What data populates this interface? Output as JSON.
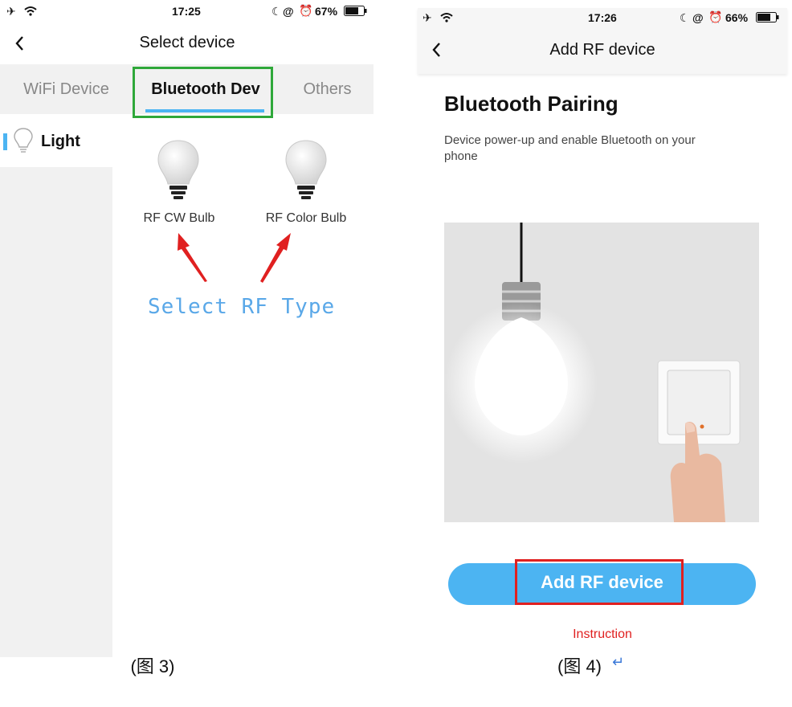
{
  "left_screen": {
    "status": {
      "time": "17:25",
      "battery": "67%"
    },
    "nav": {
      "title": "Select device"
    },
    "tabs": [
      {
        "label": "WiFi Device"
      },
      {
        "label": "Bluetooth Dev"
      },
      {
        "label": "Others"
      }
    ],
    "sidebar": {
      "items": [
        {
          "label": "Light"
        }
      ]
    },
    "devices": [
      {
        "label": "RF CW Bulb"
      },
      {
        "label": "RF Color Bulb"
      }
    ],
    "annotation": "Select RF Type",
    "caption": "(图 3)"
  },
  "right_screen": {
    "status": {
      "time": "17:26",
      "battery": "66%"
    },
    "nav": {
      "title": "Add RF device"
    },
    "heading": "Bluetooth Pairing",
    "description": "Device power-up and enable Bluetooth on your phone",
    "button_label": "Add RF device",
    "instruction_link": "Instruction",
    "caption": "(图 4)"
  },
  "colors": {
    "accent_blue": "#4cb4f2",
    "highlight_green": "#2fa83a",
    "highlight_red": "#e02020",
    "annotation_blue": "#5aa8e8"
  },
  "icons": [
    "airplane-icon",
    "wifi-icon",
    "moon-icon",
    "lock-rotation-icon",
    "alarm-icon",
    "battery-icon",
    "back-icon",
    "lightbulb-icon",
    "return-arrow-icon"
  ]
}
